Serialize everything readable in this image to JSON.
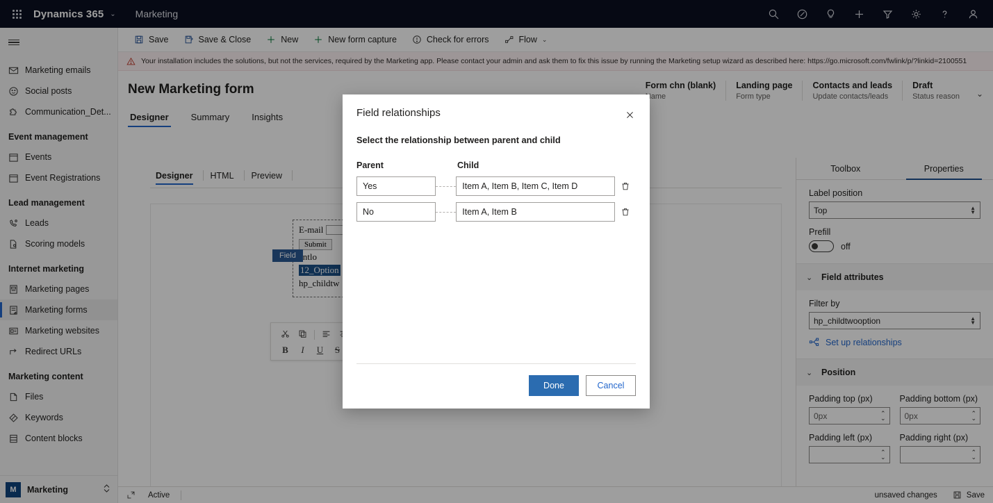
{
  "topbar": {
    "waffle_icon": "app-launcher-icon",
    "brand": "Dynamics 365",
    "brand_chevron": "⌄",
    "app_name": "Marketing",
    "icons": [
      {
        "name": "search-icon"
      },
      {
        "name": "assistant-icon"
      },
      {
        "name": "lightbulb-icon"
      },
      {
        "name": "add-icon"
      },
      {
        "name": "filter-icon"
      },
      {
        "name": "settings-gear-icon"
      },
      {
        "name": "help-icon"
      },
      {
        "name": "user-account-icon"
      }
    ]
  },
  "sidebar": {
    "items": [
      {
        "label": "Marketing emails",
        "icon": "envelope-icon",
        "selected": false
      },
      {
        "label": "Social posts",
        "icon": "smiley-icon",
        "selected": false
      },
      {
        "label": "Communication_Det...",
        "icon": "puzzle-icon",
        "selected": false
      }
    ],
    "groups": [
      {
        "title": "Event management",
        "items": [
          {
            "label": "Events",
            "icon": "calendar-icon",
            "selected": false
          },
          {
            "label": "Event Registrations",
            "icon": "calendar-icon",
            "selected": false
          }
        ]
      },
      {
        "title": "Lead management",
        "items": [
          {
            "label": "Leads",
            "icon": "lead-icon",
            "selected": false
          },
          {
            "label": "Scoring models",
            "icon": "scoring-icon",
            "selected": false
          }
        ]
      },
      {
        "title": "Internet marketing",
        "items": [
          {
            "label": "Marketing pages",
            "icon": "page-icon",
            "selected": false
          },
          {
            "label": "Marketing forms",
            "icon": "form-icon",
            "selected": true
          },
          {
            "label": "Marketing websites",
            "icon": "website-icon",
            "selected": false
          },
          {
            "label": "Redirect URLs",
            "icon": "redirect-arrow-icon",
            "selected": false
          }
        ]
      },
      {
        "title": "Marketing content",
        "items": [
          {
            "label": "Files",
            "icon": "file-icon",
            "selected": false
          },
          {
            "label": "Keywords",
            "icon": "tag-icon",
            "selected": false
          },
          {
            "label": "Content blocks",
            "icon": "blocks-icon",
            "selected": false
          }
        ]
      }
    ],
    "area": {
      "badge": "M",
      "label": "Marketing",
      "chevron": "⌃⌄"
    }
  },
  "commandbar": {
    "items": [
      {
        "label": "Save",
        "icon": "save-icon"
      },
      {
        "label": "Save & Close",
        "icon": "save-close-icon"
      },
      {
        "label": "New",
        "icon": "plus-icon"
      },
      {
        "label": "New form capture",
        "icon": "plus-icon"
      },
      {
        "label": "Check for errors",
        "icon": "error-check-icon"
      },
      {
        "label": "Flow",
        "icon": "flow-icon",
        "chevron": "⌄"
      }
    ]
  },
  "warning": {
    "icon": "warning-triangle-icon",
    "text": "Your installation includes the solutions, but not the services, required by the Marketing app. Please contact your admin and ask them to fix this issue by running the Marketing setup wizard as described here: https://go.microsoft.com/fwlink/p/?linkid=2100551"
  },
  "page": {
    "title": "New Marketing form",
    "tabs": [
      {
        "label": "Designer",
        "active": true
      },
      {
        "label": "Summary",
        "active": false
      },
      {
        "label": "Insights",
        "active": false
      }
    ],
    "header_info": [
      {
        "value": "Form chn (blank)",
        "label": "Name"
      },
      {
        "value": "Landing page",
        "label": "Form type"
      },
      {
        "value": "Contacts and leads",
        "label": "Update contacts/leads"
      },
      {
        "value": "Draft",
        "label": "Status reason"
      }
    ],
    "header_chevron": "⌄"
  },
  "designer": {
    "tabs": [
      {
        "label": "Designer",
        "active": true
      },
      {
        "label": "HTML",
        "active": false
      },
      {
        "label": "Preview",
        "active": false
      }
    ],
    "undo_icon": "undo-icon",
    "canvas": {
      "email_label": "E-mail",
      "submit_label": "Submit",
      "field_tag": "Field",
      "line_partial": "entlo",
      "option_text": "12_Option",
      "child_text": "hp_childtw"
    },
    "mini_toolbar": {
      "row1": [
        "cut-icon",
        "copy-icon",
        "align-left-icon",
        "align-center-icon"
      ],
      "bold": "B",
      "italic": "I",
      "underline": "U",
      "strike": "S"
    }
  },
  "properties": {
    "tabs": [
      {
        "label": "Toolbox",
        "active": false
      },
      {
        "label": "Properties",
        "active": true
      }
    ],
    "label_position": {
      "label": "Label position",
      "value": "Top"
    },
    "prefill": {
      "label": "Prefill",
      "state": "off"
    },
    "field_attributes": {
      "title": "Field attributes",
      "chevron": "⌄"
    },
    "filter_by": {
      "label": "Filter by",
      "value": "hp_childtwooption"
    },
    "setup_relationships": {
      "label": "Set up relationships",
      "icon": "relationships-icon"
    },
    "position": {
      "title": "Position",
      "chevron": "⌄"
    },
    "padding": [
      {
        "label": "Padding top (px)",
        "value": "0px"
      },
      {
        "label": "Padding bottom (px)",
        "value": "0px"
      },
      {
        "label": "Padding left (px)",
        "value": ""
      },
      {
        "label": "Padding right (px)",
        "value": ""
      }
    ]
  },
  "statusbar": {
    "expand_icon": "popout-icon",
    "state": "Active",
    "unsaved": "unsaved changes",
    "save_label": "Save",
    "save_icon": "save-icon"
  },
  "dialog": {
    "title": "Field relationships",
    "close_icon": "close-icon",
    "subtitle": "Select the relationship between parent and child",
    "col_parent": "Parent",
    "col_child": "Child",
    "rows": [
      {
        "parent": "Yes",
        "child": "Item A, Item B, Item C, Item D",
        "delete_icon": "trash-icon"
      },
      {
        "parent": "No",
        "child": "Item A, Item B",
        "delete_icon": "trash-icon"
      }
    ],
    "done_label": "Done",
    "cancel_label": "Cancel"
  },
  "colors": {
    "topbar_bg": "#0b1021",
    "accent_blue": "#2266cc",
    "primary_button": "#2b6cb0",
    "selected_nav": "#2266cc",
    "warning_bg": "#fdf3f4"
  }
}
